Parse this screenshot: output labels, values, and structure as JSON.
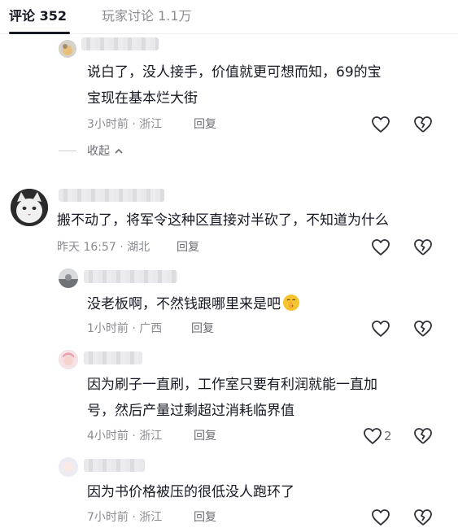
{
  "tabs": {
    "comments": "评论 352",
    "discussion": "玩家讨论 1.1万"
  },
  "collapse_label": "收起",
  "reply_label": "回复",
  "comments": [
    {
      "text_line1": "说白了，没人接手，价值就更可想而知，69的宝",
      "text_line2": "宝现在基本烂大街",
      "meta": "3小时前 · 浙江"
    },
    {
      "text_line1": "搬不动了，将军令这种区直接对半砍了，不知道为什么",
      "meta": "昨天 16:57 · 湖北"
    },
    {
      "text_line1": "没老板啊，不然钱跟哪里来是吧",
      "meta": "1小时前 · 广西"
    },
    {
      "text_line1": "因为刷子一直刷，工作室只要有利润就能一直加",
      "text_line2": "号，然后产量过剩超过消耗临界值",
      "meta": "4小时前 · 浙江",
      "like_count": "2"
    },
    {
      "text_line1": "因为书价格被压的很低没人跑环了",
      "meta": "7小时前 · 浙江"
    }
  ],
  "icons": {
    "like": "heart-outline-icon",
    "dislike": "broken-heart-icon",
    "expand": "chevron-up-icon",
    "emoji": "shushing-face-emoji"
  },
  "colors": {
    "text": "#161823",
    "meta": "#8a8b91",
    "emoji": "#f7c431"
  }
}
